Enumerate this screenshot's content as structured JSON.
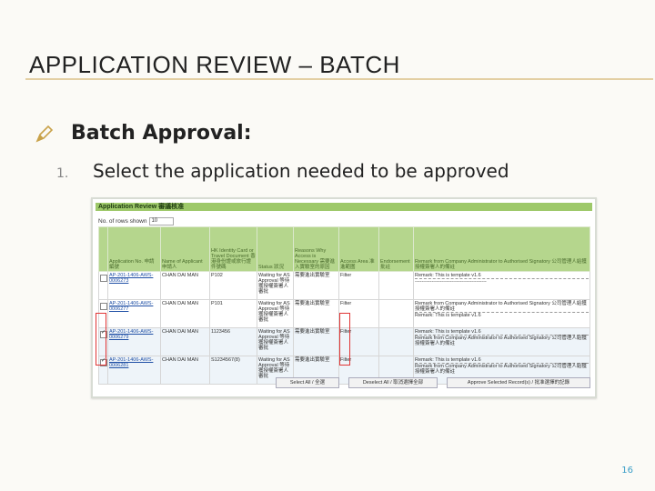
{
  "slide": {
    "title": "APPLICATION REVIEW – BATCH",
    "bullet": "Batch Approval:",
    "step_number": "1.",
    "step_text": "Select the application needed to be approved",
    "page_number": "16"
  },
  "screenshot": {
    "header": "Application Review 審議核准",
    "rows_label": "No. of rows shown",
    "rows_value": "10",
    "columns": [
      "",
      "Application No. 申請編號",
      "Name of Applicant 申請人",
      "HK Identity Card or Travel Document 香港身份證或旅行證件號碼",
      "Status 狀況",
      "Reasons Why Access is Necessary 需要進入實驗室的原因",
      "Access Area 准進範圍",
      "Endorsement 批註",
      "Remark from Company Administrator to Authorised Signatory 公司管理人給獲授權簽署人的備註"
    ],
    "rows": [
      {
        "checked": false,
        "app_no": "AP-201-1406-AWS-0006273",
        "name": "CHAN DAI MAN",
        "id": "P102",
        "status": "Waiting for AS Approval 等待獲授權簽署人審批",
        "reason": "需要進出實驗室",
        "area": "Filter",
        "endorsement": "",
        "remark_a": "Remark: This is template v1.6",
        "remark_b": "-------------------------------------------"
      },
      {
        "checked": false,
        "app_no": "AP-201-1406-AWS-0006277",
        "name": "CHAN DAI MAN",
        "id": "P101",
        "status": "Waiting for AS Approval 等待獲授權簽署人審批",
        "reason": "需要進出實驗室",
        "area": "Filter",
        "endorsement": "",
        "remark_a": "Remark from Company Administrator to Authorised Signatory 公司管理人給獲授權簽署人的備註",
        "remark_b": "Remark: This is template v1.6"
      },
      {
        "checked": true,
        "app_no": "AP-201-1406-AWS-0006279",
        "name": "CHAN DAI MAN",
        "id": "1123456",
        "status": "Waiting for AS Approval 等待獲授權簽署人審批",
        "reason": "需要進出實驗室",
        "area": "Filter",
        "endorsement": "",
        "remark_a": "Remark: This is template v1.6",
        "remark_b": "Remark from Company Administrator to Authorised Signatory 公司管理人給獲授權簽署人的備註"
      },
      {
        "checked": true,
        "app_no": "AP-201-1406-AWS-0006281",
        "name": "CHAN DAI MAN",
        "id": "S1234567(8)",
        "status": "Waiting for AS Approval 等待獲授權簽署人審批",
        "reason": "需要進出實驗室",
        "area": "Filter",
        "endorsement": "",
        "remark_a": "Remark: This is template v1.6",
        "remark_b": "Remark from Company Administrator to Authorised Signatory 公司管理人給獲授權簽署人的備註"
      }
    ],
    "buttons": {
      "select_all": "Select All / 全選",
      "deselect_all": "Deselect All / 取消選擇全部",
      "approve": "Approve Selected Record(s) / 批准選擇的記錄"
    }
  }
}
